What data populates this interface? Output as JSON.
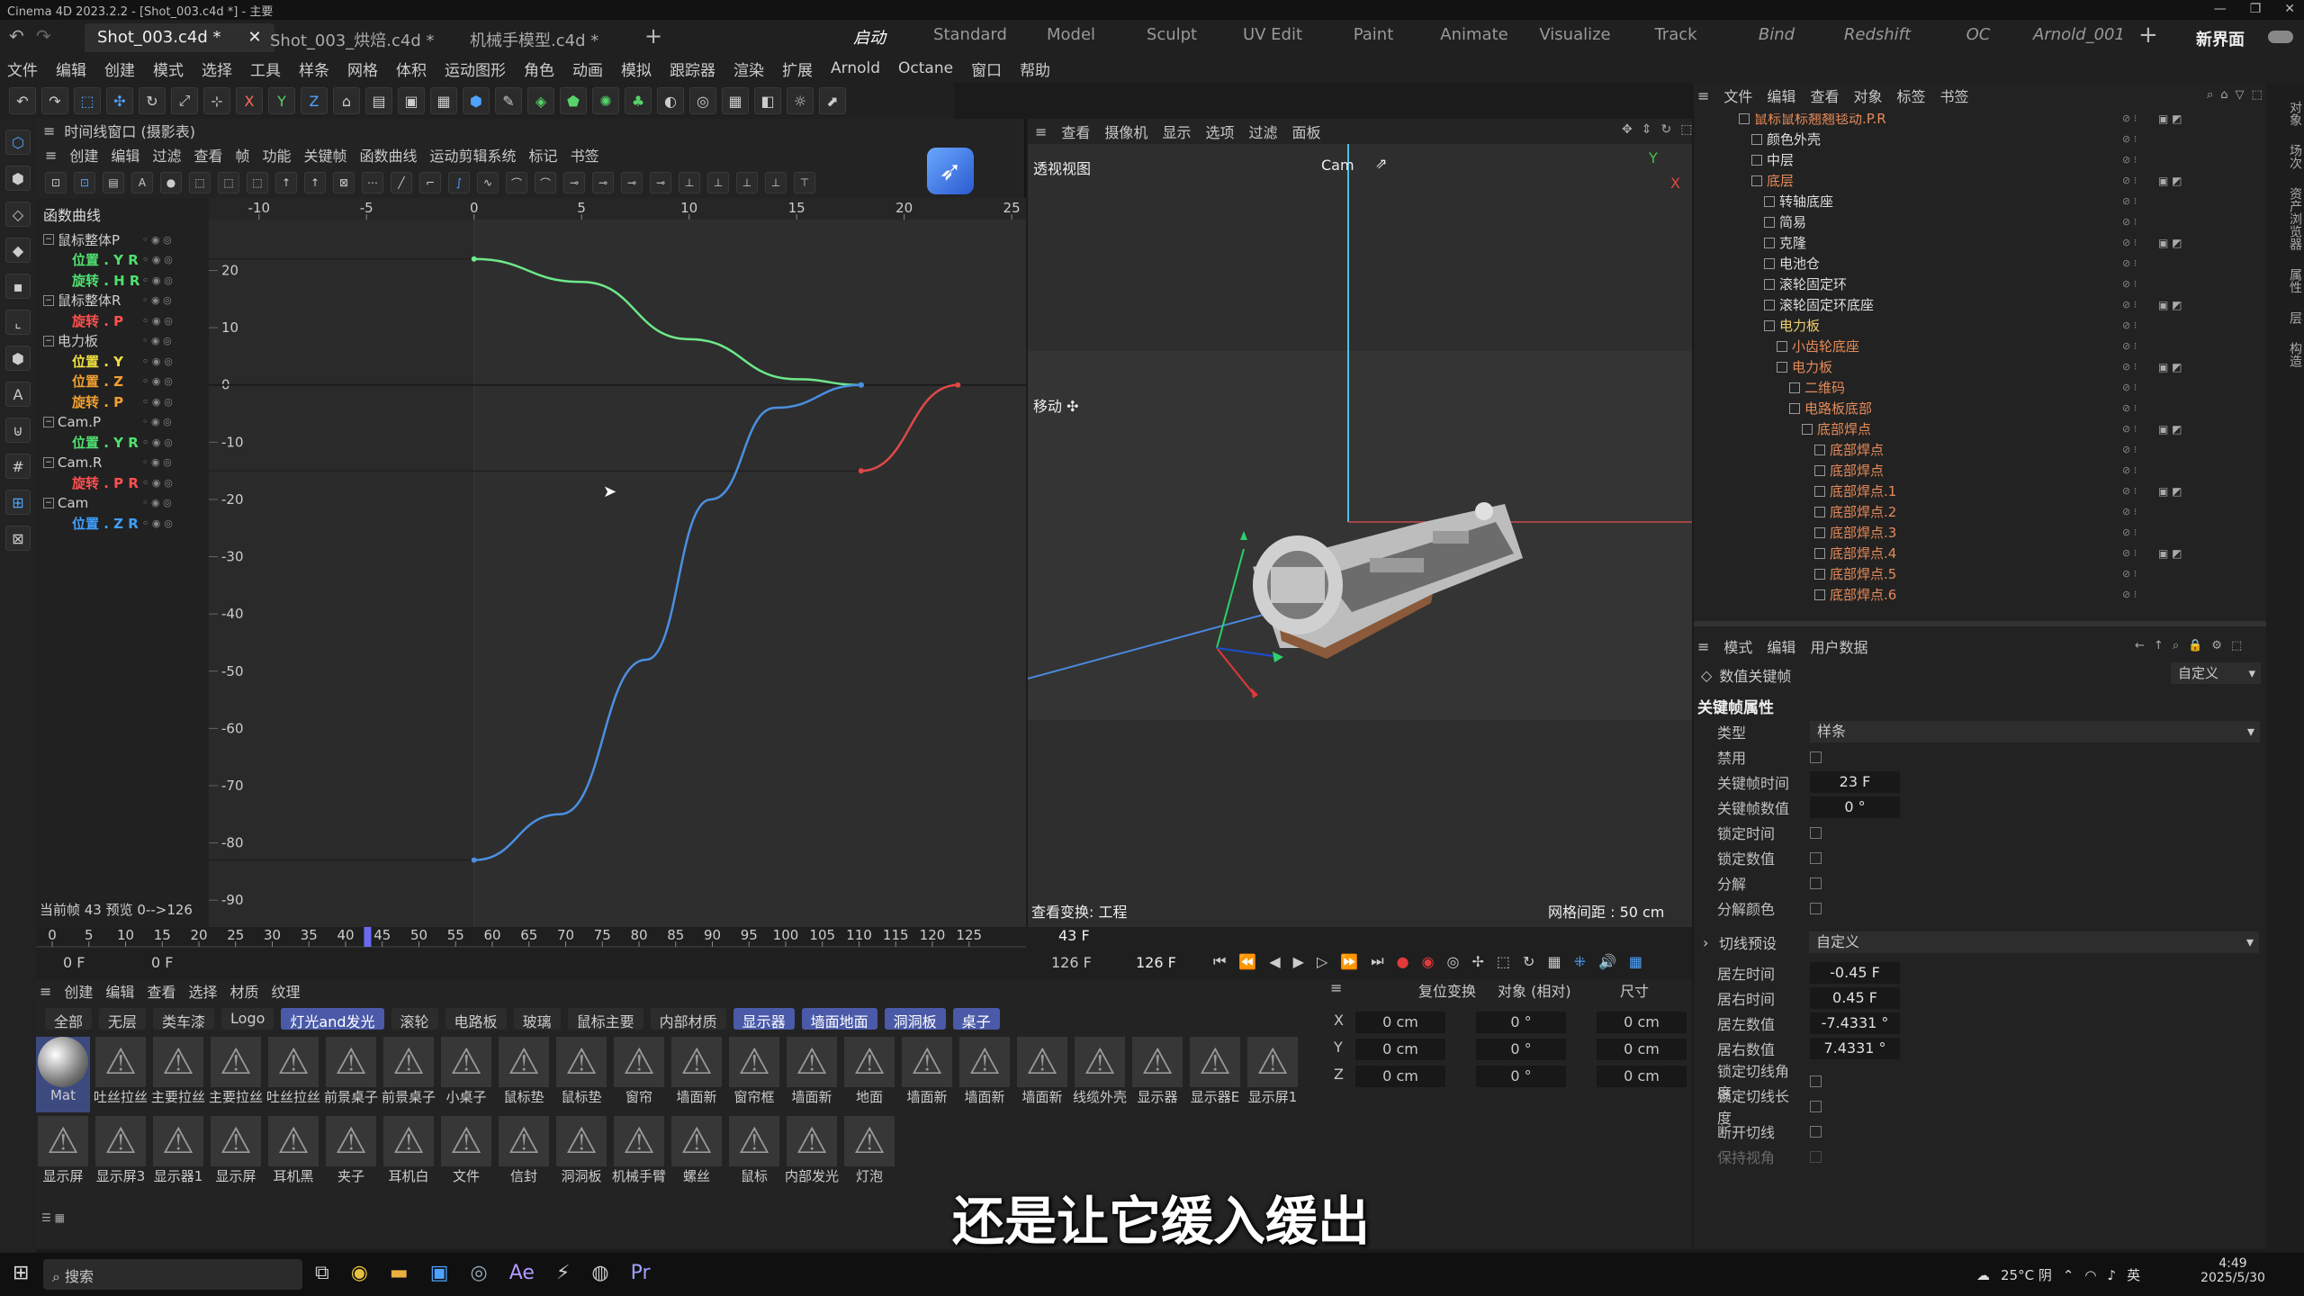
{
  "titlebar": {
    "title": "Cinema 4D 2023.2.2 - [Shot_003.c4d *] - 主要"
  },
  "tabs": [
    "Shot_003.c4d *",
    "Shot_003_烘焙.c4d *",
    "机械手模型.c4d *"
  ],
  "layouts": [
    "启动",
    "Standard",
    "Model",
    "Sculpt",
    "UV Edit",
    "Paint",
    "Animate",
    "Visualize",
    "Track",
    "Bind",
    "Redshift",
    "OC",
    "Arnold_001"
  ],
  "new_interface": "新界面",
  "menu": [
    "文件",
    "编辑",
    "创建",
    "模式",
    "选择",
    "工具",
    "样条",
    "网格",
    "体积",
    "运动图形",
    "角色",
    "动画",
    "模拟",
    "跟踪器",
    "渲染",
    "扩展",
    "Arnold",
    "Octane",
    "窗口",
    "帮助"
  ],
  "timeline": {
    "header": "时间线窗口 (摄影表)",
    "menu": [
      "创建",
      "编辑",
      "过滤",
      "查看",
      "帧",
      "功能",
      "关键帧",
      "函数曲线",
      "运动剪辑系统",
      "标记",
      "书签"
    ],
    "panel_title": "函数曲线",
    "x_ticks": [
      "-10",
      "-5",
      "0",
      "5",
      "10",
      "15",
      "20",
      "25"
    ],
    "y_ticks": [
      "20",
      "10",
      "0",
      "-10",
      "-20",
      "-30",
      "-40",
      "-50",
      "-60",
      "-70",
      "-80",
      "-90"
    ],
    "tracks": [
      {
        "label": "鼠标整体P",
        "kind": "obj"
      },
      {
        "label": "位置 . Y  R",
        "kind": "green"
      },
      {
        "label": "旋转 . H  R",
        "kind": "green"
      },
      {
        "label": "鼠标整体R",
        "kind": "obj"
      },
      {
        "label": "旋转 . P",
        "kind": "red"
      },
      {
        "label": "电力板",
        "kind": "obj"
      },
      {
        "label": "位置 . Y",
        "kind": "yellow"
      },
      {
        "label": "位置 . Z",
        "kind": "orange"
      },
      {
        "label": "旋转 . P",
        "kind": "orange"
      },
      {
        "label": "Cam.P",
        "kind": "obj"
      },
      {
        "label": "位置 . Y  R",
        "kind": "green"
      },
      {
        "label": "Cam.R",
        "kind": "obj"
      },
      {
        "label": "旋转 . P  R",
        "kind": "red"
      },
      {
        "label": "Cam",
        "kind": "obj"
      },
      {
        "label": "位置 . Z  R",
        "kind": "blue"
      }
    ],
    "status": "当前帧  43  预览  0-->126",
    "cursor_label": "43"
  },
  "viewport": {
    "menu": [
      "查看",
      "摄像机",
      "显示",
      "选项",
      "过滤",
      "面板"
    ],
    "view_name": "透视视图",
    "camera": "Cam",
    "move_label": "移动 ✣",
    "footer_left": "查看变换: 工程",
    "footer_right": "网格间距 : 50 cm"
  },
  "timebar": {
    "ticks": [
      "0",
      "5",
      "10",
      "15",
      "20",
      "25",
      "30",
      "35",
      "40",
      "45",
      "50",
      "55",
      "60",
      "65",
      "70",
      "75",
      "80",
      "85",
      "90",
      "95",
      "100",
      "105",
      "110",
      "115",
      "120",
      "125"
    ],
    "current": "43 F",
    "start": "0 F",
    "start2": "0 F",
    "end": "126 F",
    "end2": "126 F"
  },
  "materials": {
    "menu": [
      "创建",
      "编辑",
      "查看",
      "选择",
      "材质",
      "纹理"
    ],
    "tabs": [
      "全部",
      "无层",
      "类车漆",
      "Logo",
      "灯光and发光",
      "滚轮",
      "电路板",
      "玻璃",
      "鼠标主要",
      "内部材质",
      "显示器",
      "墙面地面",
      "洞洞板",
      "桌子"
    ],
    "selected_tabs": [
      "灯光and发光",
      "显示器",
      "墙面地面",
      "洞洞板",
      "桌子"
    ],
    "row1": [
      "Mat",
      "吐丝拉丝",
      "主要拉丝",
      "主要拉丝",
      "吐丝拉丝",
      "前景桌子",
      "前景桌子",
      "小桌子",
      "鼠标垫",
      "鼠标垫",
      "窗帘",
      "墙面新",
      "窗帘框",
      "墙面新",
      "地面",
      "墙面新",
      "墙面新",
      "墙面新",
      "线缆外壳",
      "显示器",
      "显示器E",
      "显示屏1"
    ],
    "row2": [
      "显示屏",
      "显示屏3",
      "显示器1",
      "显示屏",
      "耳机黑",
      "夹子",
      "耳机白",
      "文件",
      "信封",
      "洞洞板",
      "机械手臂",
      "螺丝",
      "鼠标",
      "内部发光",
      "灯泡"
    ]
  },
  "coords": {
    "reset": "复位变换",
    "object": "对象 (相对)",
    "size": "尺寸",
    "axes": [
      "X",
      "Y",
      "Z"
    ],
    "pos": [
      "0 cm",
      "0 cm",
      "0 cm"
    ],
    "rot": [
      "0 °",
      "0 °",
      "0 °"
    ],
    "sz": [
      "0 cm",
      "0 cm",
      "0 cm"
    ]
  },
  "objects": {
    "menu": [
      "文件",
      "编辑",
      "查看",
      "对象",
      "标签",
      "书签"
    ],
    "items": [
      {
        "label": "鼠标鼠标翘翘毯动.P.R",
        "c": "#e58a5a",
        "i": 1
      },
      {
        "label": "颜色外壳",
        "c": "#ddd",
        "i": 2
      },
      {
        "label": "中层",
        "c": "#ddd",
        "i": 2
      },
      {
        "label": "底层",
        "c": "#e58a5a",
        "i": 2
      },
      {
        "label": "转轴底座",
        "c": "#ddd",
        "i": 3
      },
      {
        "label": "简易",
        "c": "#ddd",
        "i": 3
      },
      {
        "label": "克隆",
        "c": "#ddd",
        "i": 3
      },
      {
        "label": "电池仓",
        "c": "#ddd",
        "i": 3
      },
      {
        "label": "滚轮固定环",
        "c": "#ddd",
        "i": 3
      },
      {
        "label": "滚轮固定环底座",
        "c": "#ddd",
        "i": 3
      },
      {
        "label": "电力板",
        "c": "#f0d070",
        "i": 3
      },
      {
        "label": "小齿轮底座",
        "c": "#e58a5a",
        "i": 4
      },
      {
        "label": "电力板",
        "c": "#e58a5a",
        "i": 4
      },
      {
        "label": "二维码",
        "c": "#e58a5a",
        "i": 5
      },
      {
        "label": "电路板底部",
        "c": "#e58a5a",
        "i": 5
      },
      {
        "label": "底部焊点",
        "c": "#e58a5a",
        "i": 6
      },
      {
        "label": "底部焊点",
        "c": "#e58a5a",
        "i": 7
      },
      {
        "label": "底部焊点",
        "c": "#e58a5a",
        "i": 7
      },
      {
        "label": "底部焊点.1",
        "c": "#e58a5a",
        "i": 7
      },
      {
        "label": "底部焊点.2",
        "c": "#e58a5a",
        "i": 7
      },
      {
        "label": "底部焊点.3",
        "c": "#e58a5a",
        "i": 7
      },
      {
        "label": "底部焊点.4",
        "c": "#e58a5a",
        "i": 7
      },
      {
        "label": "底部焊点.5",
        "c": "#e58a5a",
        "i": 7
      },
      {
        "label": "底部焊点.6",
        "c": "#e58a5a",
        "i": 7
      }
    ]
  },
  "attributes": {
    "menu": [
      "模式",
      "编辑",
      "用户数据"
    ],
    "mode": "数值关键帧",
    "mode_value": "自定义",
    "section": "关键帧属性",
    "type_label": "类型",
    "type_value": "样条",
    "rows": [
      {
        "label": "禁用",
        "kind": "chk"
      },
      {
        "label": "关键帧时间",
        "kind": "val",
        "value": "23 F"
      },
      {
        "label": "关键帧数值",
        "kind": "val",
        "value": "0 °"
      },
      {
        "label": "锁定时间",
        "kind": "chk"
      },
      {
        "label": "锁定数值",
        "kind": "chk"
      },
      {
        "label": "分解",
        "kind": "chk"
      },
      {
        "label": "分解颜色",
        "kind": "chk"
      }
    ],
    "tangent_label": "切线预设",
    "tangent_value": "自定义",
    "rows2": [
      {
        "label": "居左时间",
        "value": "-0.45 F"
      },
      {
        "label": "居右时间",
        "value": "0.45 F"
      },
      {
        "label": "居左数值",
        "value": "-7.4331 °"
      },
      {
        "label": "居右数值",
        "value": "7.4331 °"
      }
    ],
    "rows3": [
      "锁定切线角度",
      "锁定切线长度",
      "断开切线",
      "保持视角"
    ]
  },
  "rightstrip": [
    "对象",
    "场次",
    "资产浏览器",
    "属性",
    "层",
    "构造"
  ],
  "subtitle": "还是让它缓入缓出",
  "taskbar": {
    "search": "搜索",
    "weather": "25°C 阴",
    "time": "4:49",
    "date": "2025/5/30",
    "ime": "英"
  },
  "chart_data": {
    "type": "line",
    "title": "",
    "xlabel": "",
    "ylabel": "",
    "xlim": [
      -12,
      26
    ],
    "ylim": [
      -95,
      27
    ],
    "series": [
      {
        "color": "#6de88a",
        "x": [
          0,
          5,
          10,
          15,
          18
        ],
        "y": [
          22,
          18,
          8,
          1,
          0
        ]
      },
      {
        "color": "#4a90e0",
        "x": [
          0,
          4,
          8,
          11,
          14,
          18
        ],
        "y": [
          -83,
          -75,
          -48,
          -20,
          -4,
          0
        ]
      },
      {
        "color": "#e04848",
        "x": [
          18,
          22.5
        ],
        "y": [
          -15,
          0
        ]
      }
    ]
  }
}
